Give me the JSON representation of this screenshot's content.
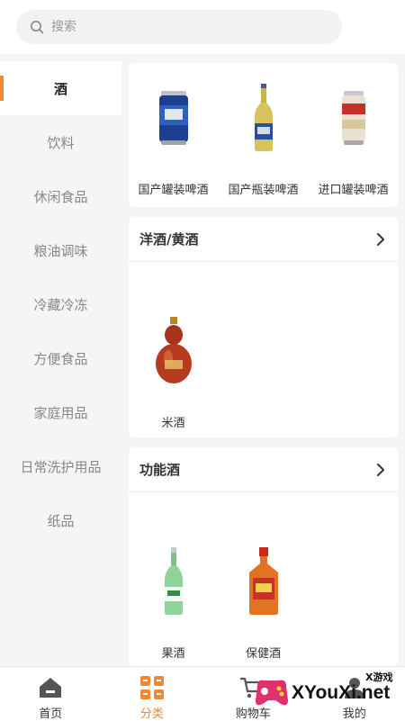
{
  "search": {
    "placeholder": "搜索"
  },
  "sidebar": {
    "items": [
      {
        "label": "酒",
        "active": true
      },
      {
        "label": "饮料"
      },
      {
        "label": "休闲食品"
      },
      {
        "label": "粮油调味"
      },
      {
        "label": "冷藏冷冻"
      },
      {
        "label": "方便食品"
      },
      {
        "label": "家庭用品"
      },
      {
        "label": "日常洗护用品"
      },
      {
        "label": "纸品"
      }
    ]
  },
  "sections": [
    {
      "title": "",
      "products": [
        {
          "name": "国产罐装啤酒",
          "icon": "blue-beer-can"
        },
        {
          "name": "国产瓶装啤酒",
          "icon": "beer-bottle"
        },
        {
          "name": "进口罐装啤酒",
          "icon": "red-beer-can"
        }
      ]
    },
    {
      "title": "洋酒/黄酒",
      "products": [
        {
          "name": "米酒",
          "icon": "gourd-bottle"
        }
      ]
    },
    {
      "title": "功能酒",
      "products": [
        {
          "name": "果酒",
          "icon": "green-bottle"
        },
        {
          "name": "保健酒",
          "icon": "orange-bottle"
        }
      ]
    }
  ],
  "tabbar": {
    "items": [
      {
        "label": "首页",
        "icon": "home-icon"
      },
      {
        "label": "分类",
        "icon": "category-icon",
        "active": true
      },
      {
        "label": "购物车",
        "icon": "cart-icon"
      },
      {
        "label": "我的",
        "icon": "user-icon"
      }
    ]
  },
  "watermark": {
    "text": "XYouXi.net",
    "subtext": "X游戏"
  },
  "colors": {
    "accent": "#f08732",
    "background": "#f5f5f5"
  }
}
